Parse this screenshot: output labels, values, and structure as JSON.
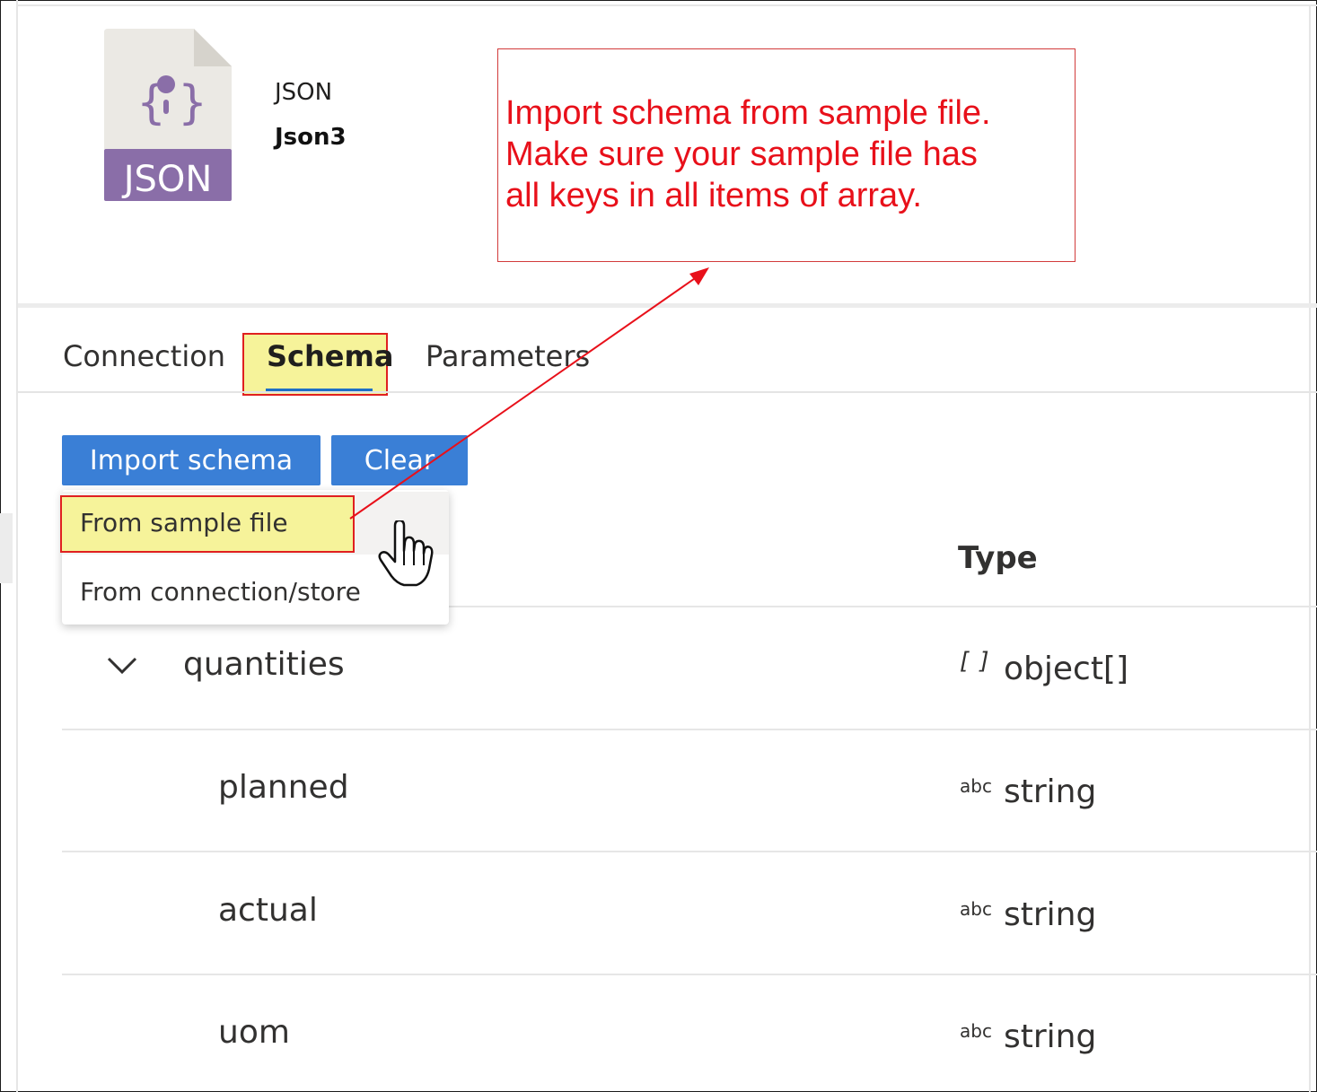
{
  "dataset": {
    "icon_label": "JSON",
    "type_label": "JSON",
    "name": "Json3"
  },
  "callout": {
    "text": "Import schema from sample file.\nMake sure your sample file has\nall keys in all items of array."
  },
  "tabs": [
    {
      "label": "Connection"
    },
    {
      "label": "Schema"
    },
    {
      "label": "Parameters"
    }
  ],
  "toolbar": {
    "import_label": "Import schema",
    "clear_label": "Clear"
  },
  "dropdown": {
    "items": [
      {
        "label": "From sample file"
      },
      {
        "label": "From connection/store"
      }
    ]
  },
  "table": {
    "type_header": "Type",
    "rows": [
      {
        "name": "quantities",
        "type_icon": "[ ]",
        "type": "object[]"
      },
      {
        "name": "planned",
        "type_icon": "abc",
        "type": "string"
      },
      {
        "name": "actual",
        "type_icon": "abc",
        "type": "string"
      },
      {
        "name": "uom",
        "type_icon": "abc",
        "type": "string"
      }
    ]
  },
  "colors": {
    "accent": "#3a7fd6",
    "highlight": "#f6f39a",
    "annotation_red": "#e8101a",
    "icon_purple": "#8a6ea8"
  }
}
